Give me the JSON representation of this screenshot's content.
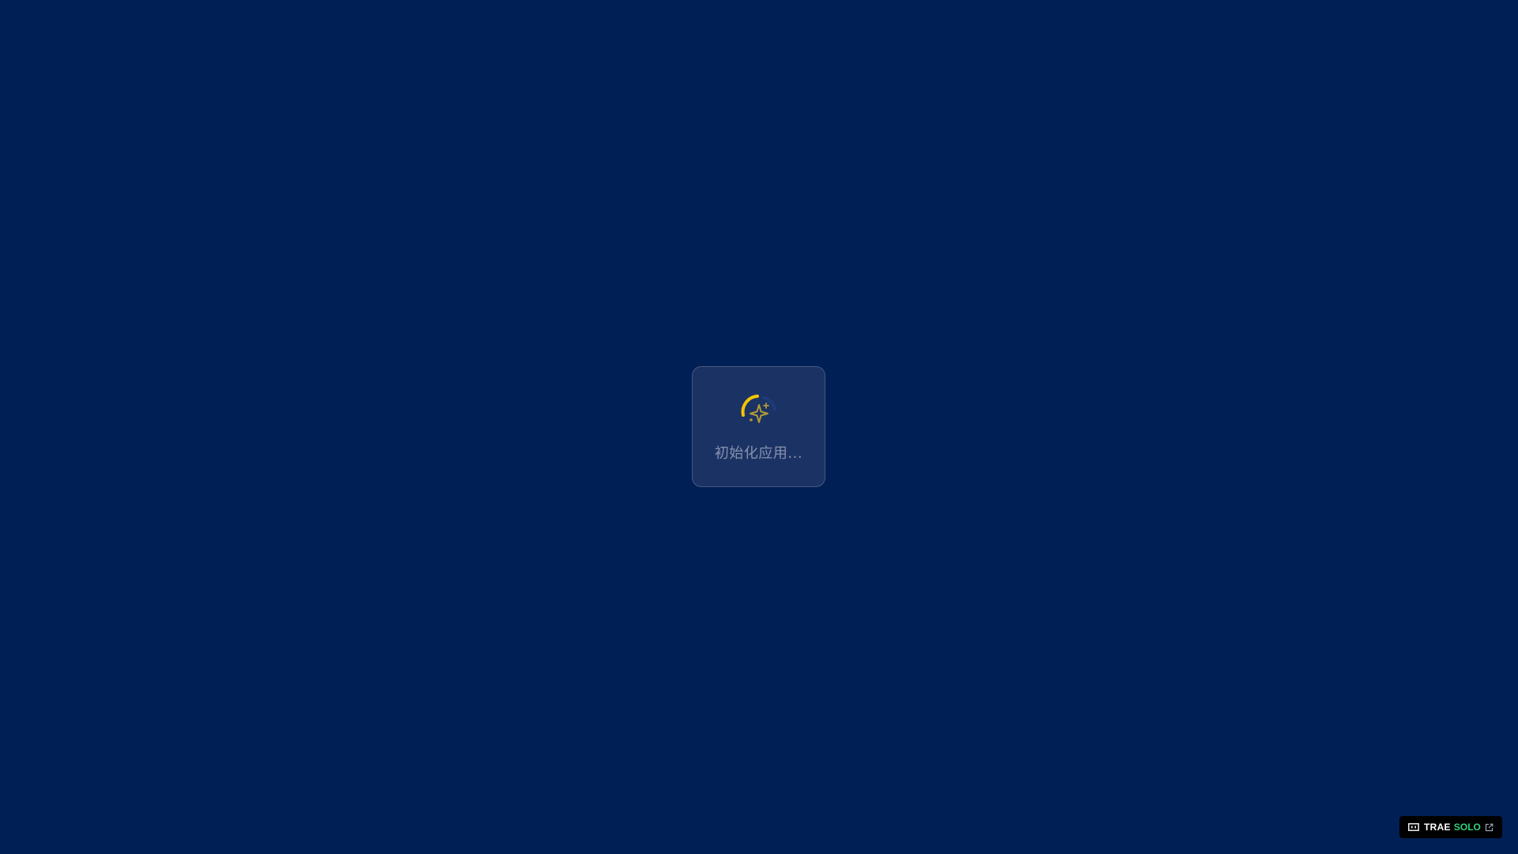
{
  "loading": {
    "message": "初始化应用...",
    "spinner_icon": "sparkle-spinner-icon"
  },
  "badge": {
    "brand": "TRAE",
    "product": "SOLO",
    "logo_icon": "trae-logo-icon",
    "link_icon": "external-link-icon"
  },
  "colors": {
    "background": "#001f54",
    "card": "#1b3364",
    "spinner_accent": "#f5c400",
    "loading_text": "#8792ad",
    "badge_product": "#33d17a"
  }
}
